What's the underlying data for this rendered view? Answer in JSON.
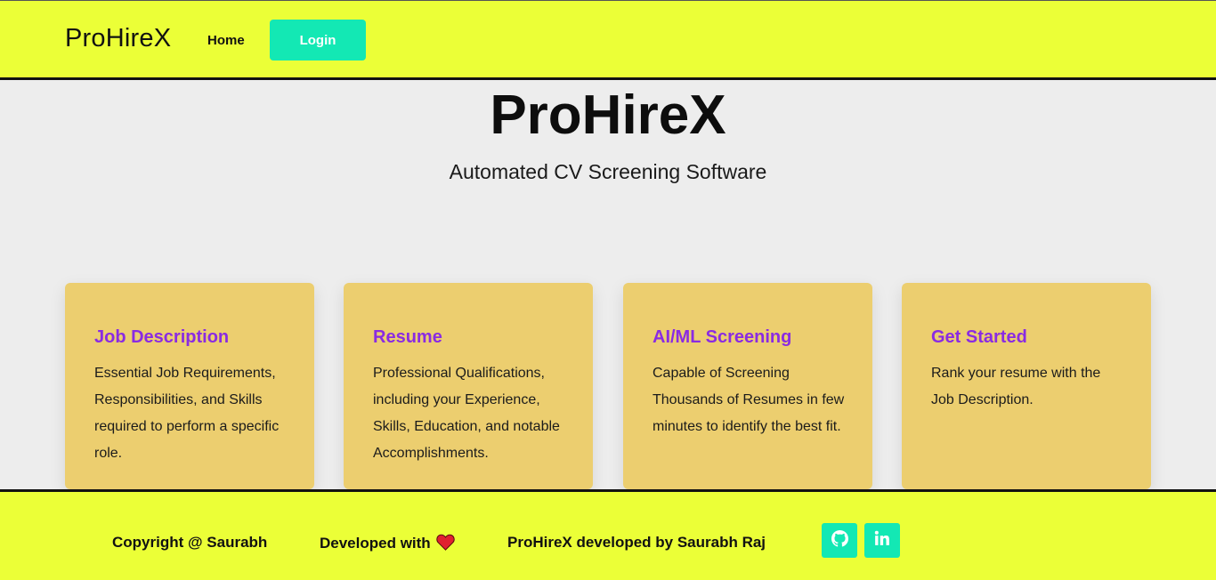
{
  "navbar": {
    "brand": "ProHireX",
    "home_label": "Home",
    "login_label": "Login"
  },
  "hero": {
    "title": "ProHireX",
    "subtitle": "Automated CV Screening Software"
  },
  "cards": [
    {
      "title": "Job Description",
      "text": "Essential Job Requirements, Responsibilities, and Skills required to perform a specific role."
    },
    {
      "title": "Resume",
      "text": "Professional Qualifications, including your Experience, Skills, Education, and notable Accomplishments."
    },
    {
      "title": "AI/ML Screening",
      "text": "Capable of Screening Thousands of Resumes in few minutes to identify the best fit."
    },
    {
      "title": "Get Started",
      "text": "Rank your resume with the Job Description."
    }
  ],
  "footer": {
    "copyright": "Copyright @ Saurabh",
    "developed_with": "Developed with",
    "heart_icon": "heart-icon",
    "credit": "ProHireX developed by Saurabh Raj",
    "social": [
      {
        "icon": "github-icon"
      },
      {
        "icon": "linkedin-icon"
      }
    ]
  },
  "colors": {
    "accent_yellow": "#ebff37",
    "accent_teal": "#13e8b4",
    "card_bg": "#ecce6f",
    "card_title": "#8a2be2",
    "heart": "#e0202f"
  }
}
